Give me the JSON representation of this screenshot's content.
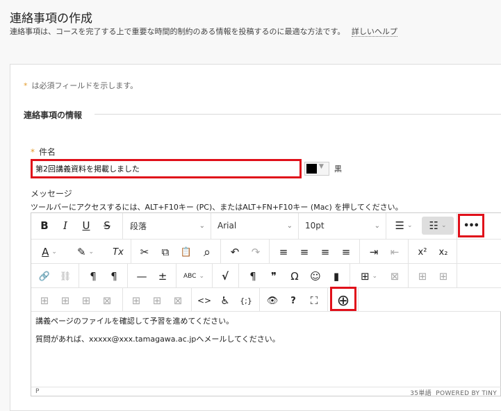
{
  "page": {
    "title": "連絡事項の作成",
    "description": "連絡事項は、コースを完了する上で重要な時間的制約のある情報を投稿するのに最適な方法です。",
    "help_link": "詳しいヘルプ"
  },
  "form": {
    "required_note": "は必須フィールドを示します。",
    "required_star": "*",
    "section_title": "連絡事項の情報",
    "subject_label": "件名",
    "subject_value": "第2回講義資料を掲載しました",
    "color_name": "黒",
    "color_value": "#000000",
    "message_label": "メッセージ",
    "message_hint": "ツールバーにアクセスするには、ALT+F10キー (PC)、またはALT+FN+F10キー (Mac) を押してください。"
  },
  "editor": {
    "format_select": "段落",
    "font_select": "Arial",
    "size_select": "10pt",
    "content": [
      "講義ページのファイルを確認して予習を進めてください。",
      "質問があれば、xxxxx@xxx.tamagawa.ac.jpへメールしてください。"
    ],
    "status_path": "P",
    "word_count": "35単語",
    "powered_by": "POWERED BY TINY"
  },
  "icons": {
    "bold": "B",
    "italic": "I",
    "underline": "U",
    "strike": "S",
    "bullet_list": "☰",
    "num_list": "☷",
    "more": "•••",
    "text_color": "A",
    "highlight": "✎",
    "clear_format": "Tx",
    "cut": "✂",
    "copy": "⧉",
    "paste": "📋",
    "find": "⌕",
    "undo": "↶",
    "redo": "↷",
    "align_left": "≡",
    "align_center": "≡",
    "align_right": "≡",
    "justify": "≡",
    "indent": "⇥",
    "outdent": "⇤",
    "superscript": "x²",
    "subscript": "x₂",
    "link": "🔗",
    "unlink": "⛓",
    "ltr": "¶",
    "rtl": "¶",
    "hr": "—",
    "insert": "±",
    "spellcheck": "ABC",
    "math": "√",
    "pilcrow": "¶",
    "quote": "❞",
    "omega": "Ω",
    "emoji": "☺",
    "bookmark": "▮",
    "table": "⊞",
    "table_x": "⊠",
    "code": "<>",
    "accessibility": "♿",
    "source": "{;}",
    "preview": "👁",
    "help": "?",
    "fullscreen": "⛶",
    "add": "⊕"
  }
}
